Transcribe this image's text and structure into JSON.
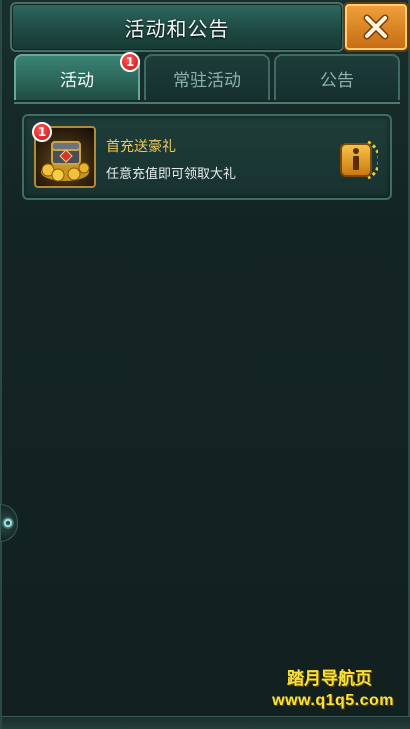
{
  "window": {
    "title": "活动和公告"
  },
  "close": {
    "icon": "close-icon"
  },
  "tabs": [
    {
      "label": "活动",
      "active": true,
      "badge": "1"
    },
    {
      "label": "常驻活动",
      "active": false
    },
    {
      "label": "公告",
      "active": false
    }
  ],
  "events": [
    {
      "title": "首充送豪礼",
      "subtitle": "任意充值即可领取大礼",
      "badge": "1",
      "icon": "treasure-chest-icon",
      "action_icon": "info-icon"
    }
  ],
  "watermark": {
    "line1": "踏月导航页",
    "line2": "www.q1q5.com"
  },
  "colors": {
    "accent": "#f0c85a",
    "badge": "#c70d0d",
    "tab_active": "#2a6457"
  }
}
